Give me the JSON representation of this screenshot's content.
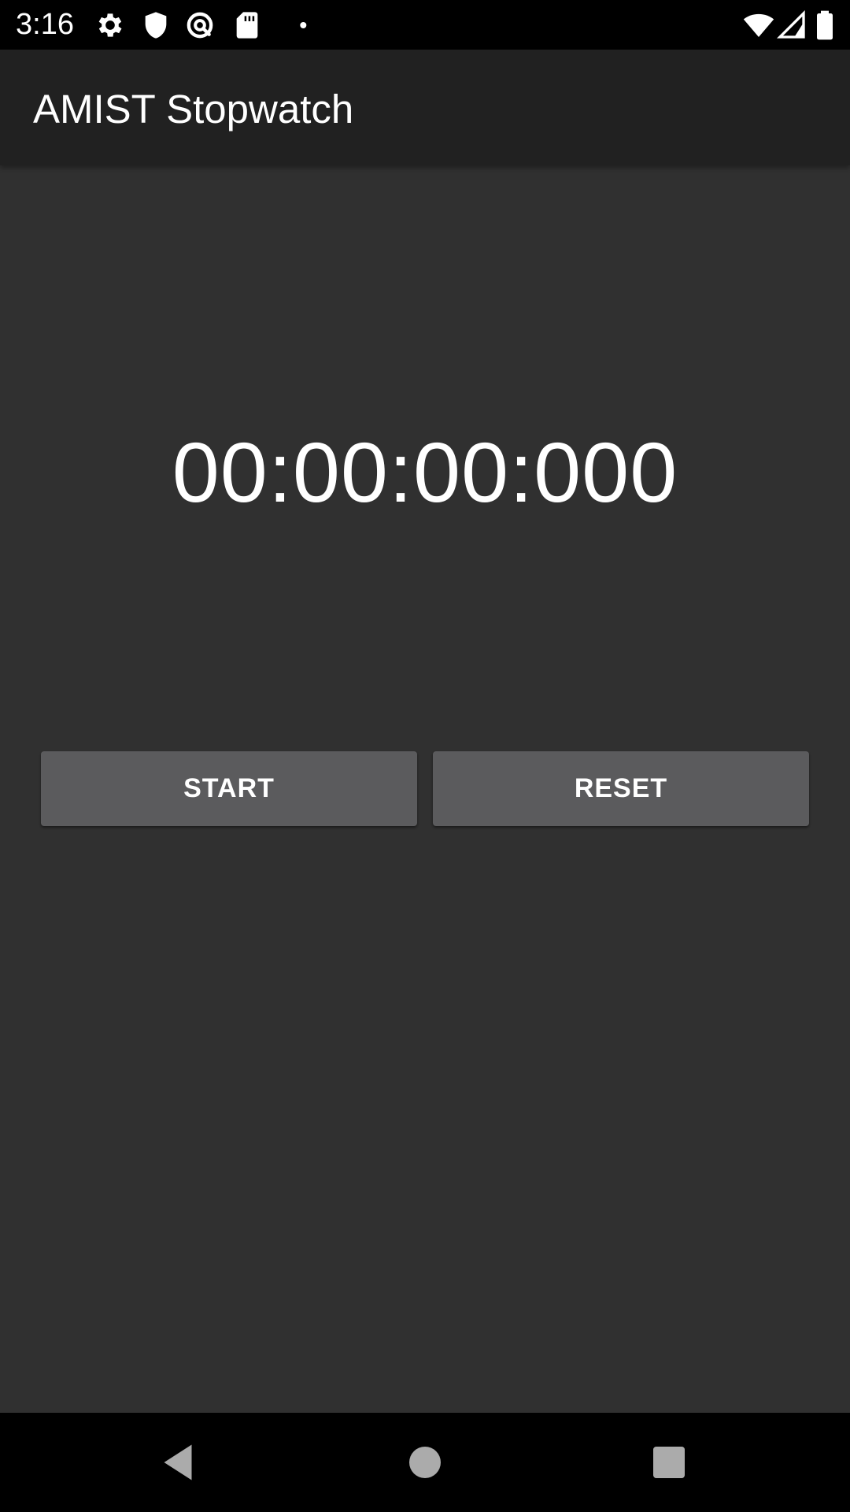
{
  "status_bar": {
    "time": "3:16",
    "icons": [
      "gear-icon",
      "shield-icon",
      "vpn-key-icon",
      "sd-card-icon",
      "notification-dot-icon",
      "wifi-icon",
      "signal-icon",
      "battery-icon"
    ]
  },
  "app_bar": {
    "title": "AMIST Stopwatch"
  },
  "timer": {
    "display": "00:00:00:000"
  },
  "buttons": {
    "start_label": "START",
    "reset_label": "RESET"
  },
  "nav_bar": {
    "icons": [
      "back-icon",
      "home-icon",
      "recents-icon"
    ]
  },
  "colors": {
    "background": "#303030",
    "app_bar": "#212121",
    "button": "#5b5b5d",
    "text": "#ffffff"
  }
}
